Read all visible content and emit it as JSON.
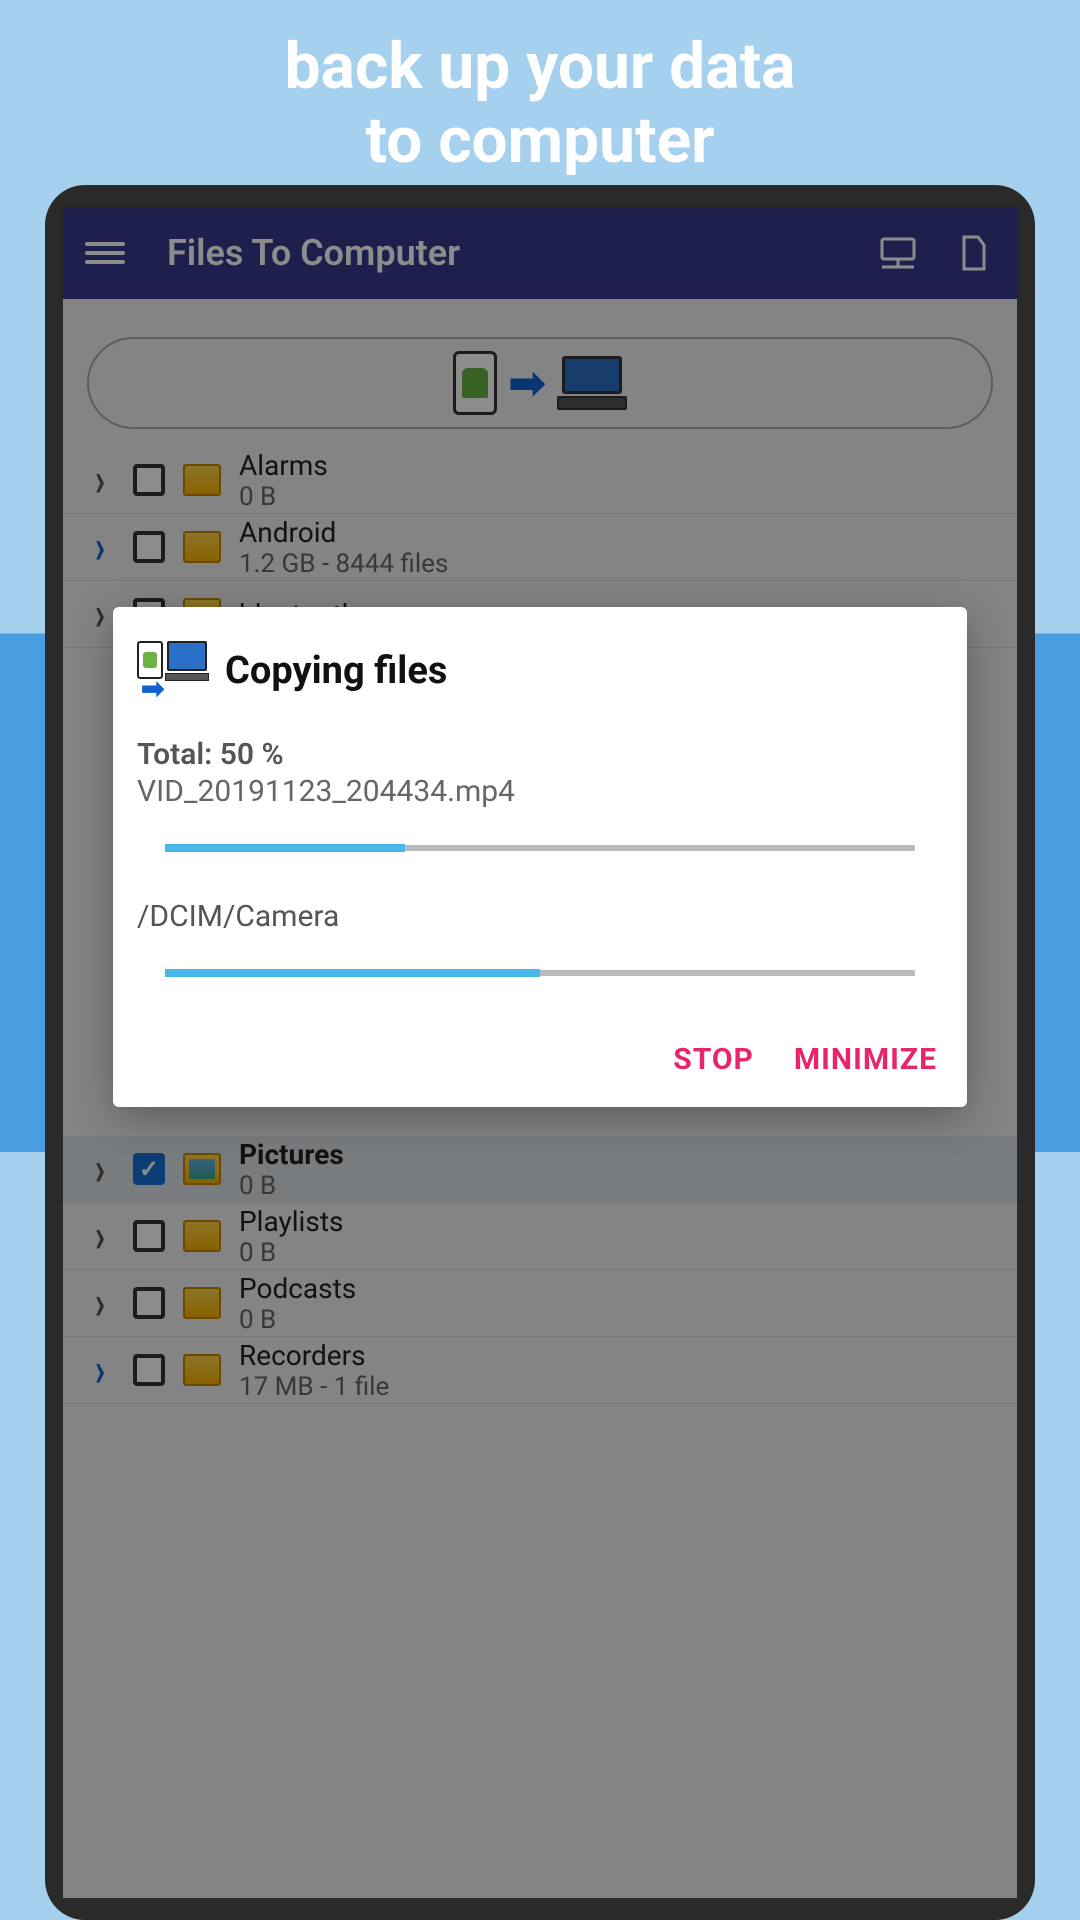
{
  "promo": {
    "line1": "back up your data",
    "line2": "to computer"
  },
  "appbar": {
    "title": "Files To Computer"
  },
  "folders": [
    {
      "name": "Alarms",
      "meta": "0 B",
      "chevron_blue": false,
      "checked": false,
      "pic": false,
      "selected": false
    },
    {
      "name": "Android",
      "meta": "1.2 GB - 8444 files",
      "chevron_blue": true,
      "checked": false,
      "pic": false,
      "selected": false
    },
    {
      "name": "bluetooth",
      "meta": "",
      "chevron_blue": false,
      "checked": false,
      "pic": false,
      "selected": false
    },
    {
      "name": "Pictures",
      "meta": "0 B",
      "chevron_blue": false,
      "checked": true,
      "pic": true,
      "selected": true
    },
    {
      "name": "Playlists",
      "meta": "0 B",
      "chevron_blue": false,
      "checked": false,
      "pic": false,
      "selected": false
    },
    {
      "name": "Podcasts",
      "meta": "0 B",
      "chevron_blue": false,
      "checked": false,
      "pic": false,
      "selected": false
    },
    {
      "name": "Recorders",
      "meta": "17 MB - 1 file",
      "chevron_blue": true,
      "checked": false,
      "pic": false,
      "selected": false
    }
  ],
  "dialog": {
    "title": "Copying files",
    "total_label": "Total: 50 %",
    "current_file": "VID_20191123_204434.mp4",
    "progress_file_pct": 32,
    "dest_path": "/DCIM/Camera",
    "progress_total_pct": 50,
    "btn_stop": "STOP",
    "btn_minimize": "MINIMIZE"
  }
}
